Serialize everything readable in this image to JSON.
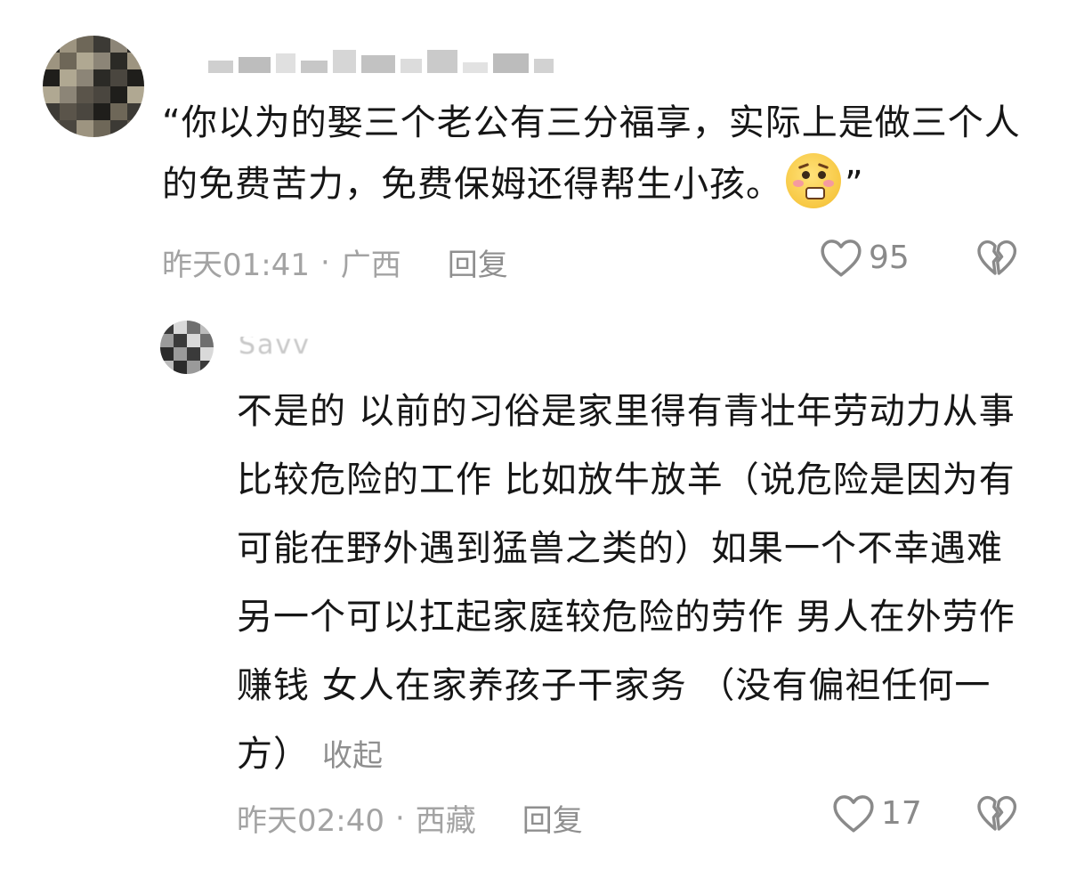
{
  "comment": {
    "username": "",
    "text_before_emoji": "“你以为的娶三个老公有三分福享，实际上是做三个人的免费苦力，免费保姆还得帮生小孩。",
    "emoji": "pleading-face-emoji",
    "text_after_emoji": "”",
    "time": "昨天01:41",
    "separator": "·",
    "location": "广西",
    "reply_label": "回复",
    "like_count": "95"
  },
  "reply": {
    "username": "Savv",
    "text": "不是的 以前的习俗是家里得有青壮年劳动力从事比较危险的工作 比如放牛放羊（说危险是因为有可能在野外遇到猛兽之类的）如果一个不幸遇难 另一个可以扛起家庭较危险的劳作  男人在外劳作赚钱 女人在家养孩子干家务 （没有偏袒任何一方）",
    "collapse_label": "收起",
    "time": "昨天02:40",
    "separator": "·",
    "location": "西藏",
    "reply_label": "回复",
    "like_count": "17"
  },
  "icons": {
    "like": "heart-outline-icon",
    "dislike": "broken-heart-icon"
  },
  "colors": {
    "text": "#161616",
    "meta": "#a3a3a3",
    "icon": "#8a8a8a"
  }
}
